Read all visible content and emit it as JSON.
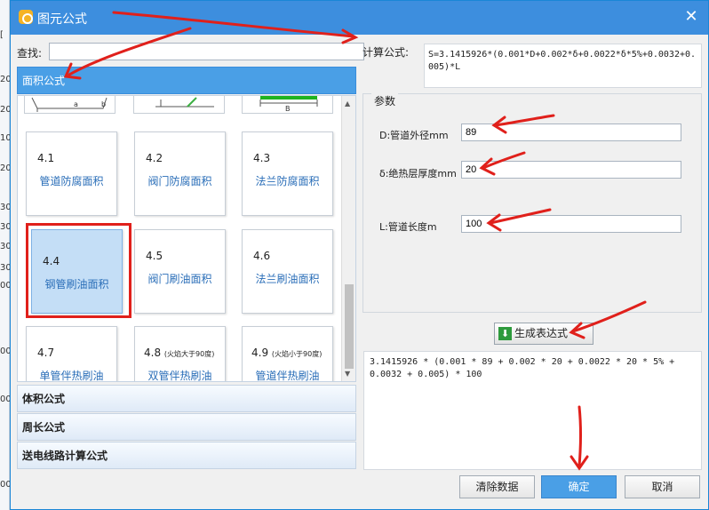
{
  "background_edge": {
    "fragments": [
      "[",
      "20",
      "20",
      "10",
      "20",
      "30",
      "30",
      "30",
      "30",
      "00",
      "00",
      "00",
      "00"
    ]
  },
  "window": {
    "title": "图元公式",
    "close_glyph": "✕"
  },
  "search": {
    "label": "查找:",
    "value": ""
  },
  "categories": {
    "area": "面积公式",
    "volume": "体积公式",
    "perimeter": "周长公式",
    "transmission": "送电线路计算公式"
  },
  "partial_cards": {
    "left_labels": [
      "a",
      "b"
    ],
    "right_label": "B"
  },
  "cards": [
    {
      "number": "4.1",
      "note": "",
      "name": "管道防腐面积"
    },
    {
      "number": "4.2",
      "note": "",
      "name": "阀门防腐面积"
    },
    {
      "number": "4.3",
      "note": "",
      "name": "法兰防腐面积"
    },
    {
      "number": "4.4",
      "note": "",
      "name": "钢管刷油面积"
    },
    {
      "number": "4.5",
      "note": "",
      "name": "阀门刷油面积"
    },
    {
      "number": "4.6",
      "note": "",
      "name": "法兰刷油面积"
    },
    {
      "number": "4.7",
      "note": "",
      "name": "单管伴热刷油"
    },
    {
      "number": "4.8",
      "note": "(火焰大于90度)",
      "name": "双管伴热刷油"
    },
    {
      "number": "4.9",
      "note": "(火焰小于90度)",
      "name": "管道伴热刷油"
    }
  ],
  "selected_card": "4.4",
  "formula": {
    "label": "计算公式:",
    "value": "S=3.1415926*(0.001*D+0.002*δ+0.0022*δ*5%+0.0032+0.005)*L"
  },
  "params": {
    "title": "参数",
    "items": [
      {
        "label": "D:管道外径mm",
        "value": "89"
      },
      {
        "label": "δ:绝热层厚度mm",
        "value": "20"
      },
      {
        "label": "L:管道长度m",
        "value": "100"
      }
    ]
  },
  "generate_button": {
    "label": "生成表达式",
    "icon": "download-arrow-icon"
  },
  "result": {
    "value": "3.1415926 * (0.001 * 89 + 0.002 * 20 + 0.0022 * 20 * 5% + 0.0032 + 0.005) * 100"
  },
  "buttons": {
    "clear": "清除数据",
    "ok": "确定",
    "cancel": "取消"
  },
  "colors": {
    "titlebar": "#3d8ede",
    "accent": "#4a9fe6",
    "annotation_red": "#e0201b",
    "link_blue": "#2a6eb8",
    "selected_bg": "#c4def6"
  }
}
